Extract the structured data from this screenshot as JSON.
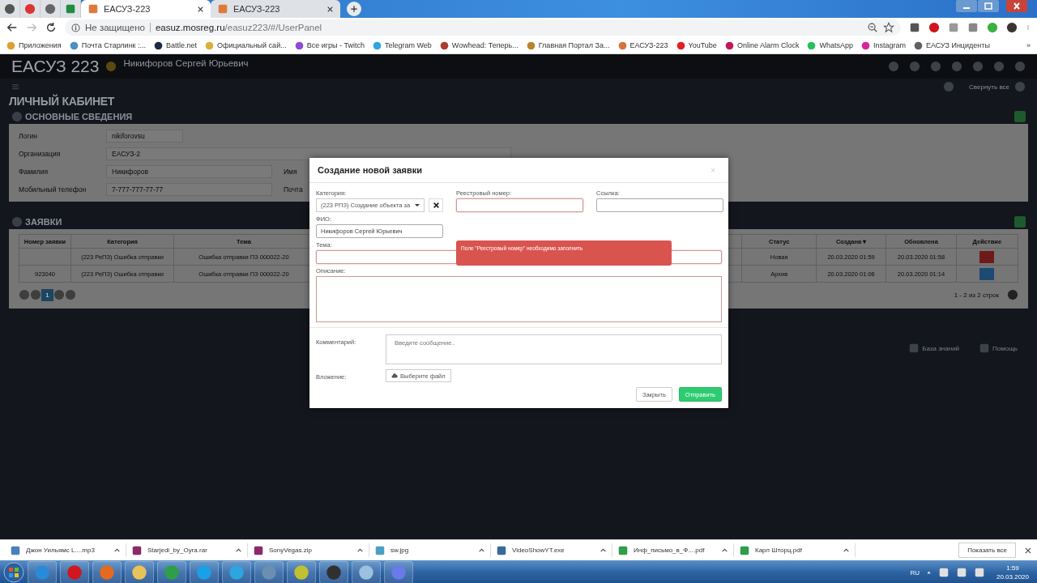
{
  "browser": {
    "tabs": [
      {
        "title": "ЕАСУЗ-223",
        "selected": true
      },
      {
        "title": "ЕАСУЗ-223",
        "selected": false
      }
    ],
    "address": {
      "security": "Не защищено",
      "domain": "easuz.mosreg.ru",
      "path": "/easuz223/#/UserPanel"
    },
    "bookmarks": [
      "Приложения",
      "Почта Старлинк :...",
      "Battle.net",
      "Официальный сай...",
      "Все игры - Twitch",
      "Telegram Web",
      "Wowhead: Теперь...",
      "Главная Портал За...",
      "ЕАСУЗ-223",
      "YouTube",
      "Online Alarm Clock",
      "WhatsApp",
      "Instagram",
      "ЕАСУЗ Инциденты"
    ],
    "bookmarks_more": "»"
  },
  "app": {
    "logo": "ЕАСУЗ 223",
    "user": "Никифоров Сергей Юрьевич",
    "collapse_all": "Свернуть все",
    "page_title": "ЛИЧНЫЙ КАБИНЕТ",
    "info_section": {
      "title": "ОСНОВНЫЕ СВЕДЕНИЯ",
      "rows": [
        {
          "fields": [
            {
              "label": "Логин",
              "value": "nikiforovsu",
              "kind": "short"
            }
          ]
        },
        {
          "fields": [
            {
              "label": "Организация",
              "value": "ЕАСУЗ-2",
              "kind": "wide"
            }
          ]
        },
        {
          "fields": [
            {
              "label": "Фамилия",
              "value": "Никифоров",
              "kind": "half"
            },
            {
              "label": "Имя"
            }
          ]
        },
        {
          "fields": [
            {
              "label": "Мобильный телефон",
              "value": "7-777-777-77-77",
              "kind": "half"
            },
            {
              "label": "Почта"
            }
          ]
        }
      ]
    },
    "requests": {
      "title": "ЗАЯВКИ",
      "columns": [
        "Номер заявки",
        "Категория",
        "Тема",
        "",
        "Статус",
        "Создана ▾",
        "Обновлена",
        "Действие"
      ],
      "rows": [
        {
          "number": "",
          "category": "(223 РеПЗ) Ошибка отправки",
          "subject": "Ошибка отправки ПЗ 000022-20",
          "status": "Новая",
          "created": "20.03.2020 01:59",
          "updated": "20.03.2020 01:58",
          "action": {
            "kind": "delete"
          }
        },
        {
          "number": "923040",
          "category": "(223 РеПЗ) Ошибка отправки",
          "subject": "Ошибка отправки ПЗ 000022-20",
          "status": "Архив",
          "created": "20.03.2020 01:06",
          "updated": "20.03.2020 01:14",
          "action": {
            "kind": "edit"
          }
        }
      ],
      "pages": [
        {
          "label": "1",
          "selected": true
        }
      ],
      "pager_info": "1 - 2 из 2 строк"
    },
    "footer_links": [
      "База знаний",
      "Помощь"
    ]
  },
  "modal": {
    "title": "Создание новой заявки",
    "close": "×",
    "category": {
      "label": "Категория:",
      "value": "(223 РПЗ) Создание объекта за"
    },
    "registry": {
      "label": "Реестровый номер:",
      "invalid": true
    },
    "link": {
      "label": "Ссылка:",
      "invalid": false
    },
    "fio": {
      "label": "ФИО:",
      "value": "Никифоров Сергей Юрьевич"
    },
    "subject": {
      "label": "Тема:",
      "invalid": true
    },
    "description": {
      "label": "Описание:",
      "invalid": true
    },
    "error": "Поле \"Реестровый номер\" необходимо заполнить",
    "comment": {
      "label": "Комментарий:",
      "placeholder": "Введите сообщение.."
    },
    "attachment": {
      "label": "Вложение:",
      "button": "Выберите файл"
    },
    "buttons": [
      {
        "label": "Закрыть",
        "kind": "default"
      },
      {
        "label": "Отправить",
        "kind": "primary"
      }
    ]
  },
  "downloads": {
    "files": [
      {
        "name": "Джон Уильямс L....mp3",
        "kind": "audio"
      },
      {
        "name": "Starjedi_by_Oyra.rar",
        "kind": "archive"
      },
      {
        "name": "SonyVegas.zip",
        "kind": "archive"
      },
      {
        "name": "sw.jpg",
        "kind": "image"
      },
      {
        "name": "VideoShowYT.exe",
        "kind": "program"
      },
      {
        "name": "Инф_письмо_в_Ф....pdf",
        "kind": "pdf"
      },
      {
        "name": "Карл Шторц.pdf",
        "kind": "pdf"
      }
    ],
    "show_all": "Показать все"
  },
  "taskbar": {
    "language": "RU",
    "time": "1:59",
    "date": "20.03.2020"
  }
}
